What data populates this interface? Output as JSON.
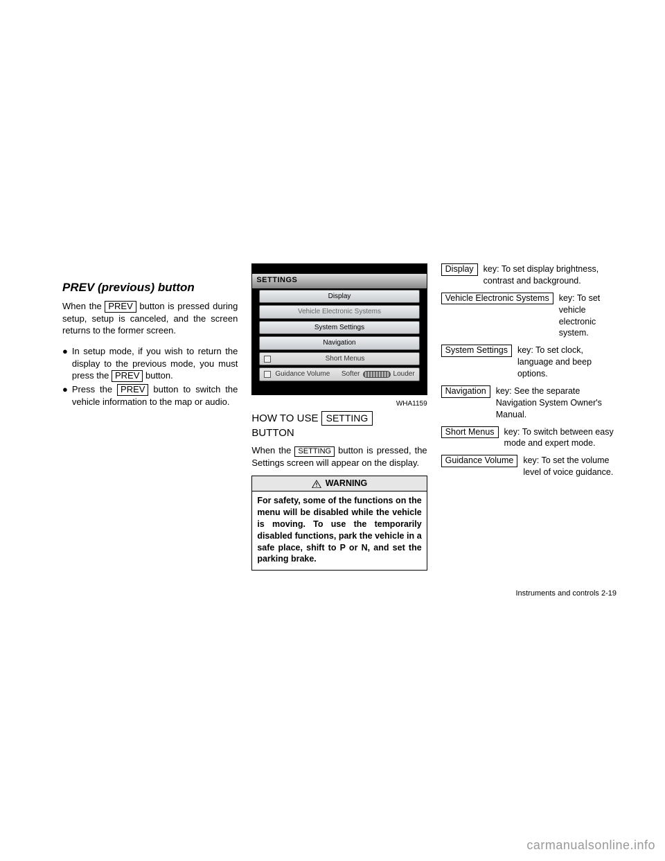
{
  "col1": {
    "heading": "PREV (previous) button",
    "intro_a": "When the ",
    "intro_btn": "PREV",
    "intro_b": " button is pressed during setup, setup is canceled, and the screen returns to the former screen.",
    "bullet1": "In setup mode, if you wish to return the display to the previous mode, you must press the",
    "bullet1_btn": "PREV",
    "bullet1_b": " button.",
    "bullet2_a": "Press the ",
    "bullet2_btn": "PREV",
    "bullet2_b": " button to switch the vehicle information to the map or audio."
  },
  "col2": {
    "shot_title": "SETTINGS",
    "menu": {
      "display": "Display",
      "ves": "Vehicle Electronic Systems",
      "system": "System Settings",
      "nav": "Navigation",
      "short": "Short Menus",
      "gv_label": "Guidance Volume",
      "softer": "Softer",
      "louder": "Louder"
    },
    "imgtag": "WHA1159",
    "heading_a": "HOW TO USE ",
    "heading_btn": "SETTING",
    "heading_b": " BUTTON",
    "line1_a": "When the ",
    "line1_btn": "SETTING",
    "line1_b": " button is pressed, the Settings screen will appear on the display.",
    "warn_hdr": "WARNING",
    "warn_body": "For safety, some of the functions on the menu will be disabled while the vehicle is moving. To use the temporarily disabled functions, park the vehicle in a safe place, shift to P or N, and set the parking brake."
  },
  "col3": {
    "items0_lbl": "Display",
    "items0_desc": " key: To set display brightness, contrast and background.",
    "items1_lbl": "Vehicle Electronic Systems",
    "items1_desc": " key: To set vehicle electronic system.",
    "items2_lbl": "System Settings",
    "items2_desc": " key: To set clock, language and beep options.",
    "items3_lbl": "Navigation",
    "items3_desc": " key: See the separate Navigation System Owner's Manual.",
    "items4_lbl": "Short Menus",
    "items4_desc": " key: To switch between easy mode and expert mode.",
    "items5_lbl": "Guidance Volume",
    "items5_desc": " key: To set the volume level of voice guidance."
  },
  "page_number": "Instruments and controls    2-19",
  "watermark": "carmanualsonline.info"
}
